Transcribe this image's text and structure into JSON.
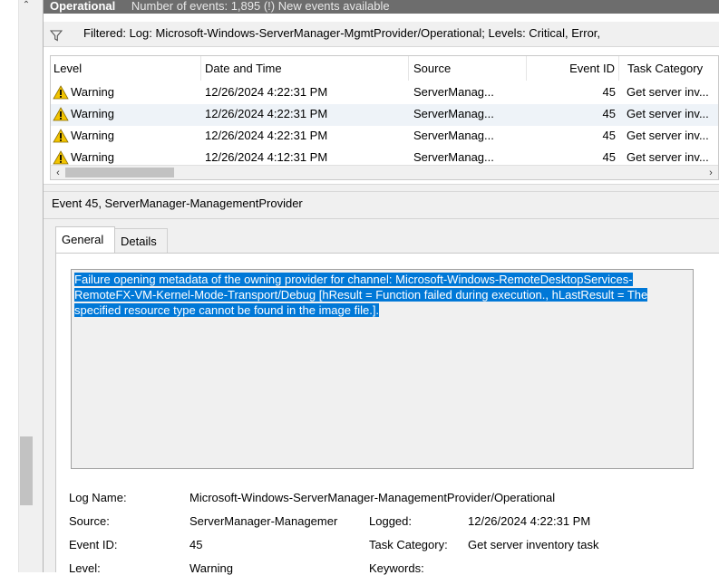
{
  "header": {
    "log_name": "Operational",
    "event_count": "Number of events: 1,895 (!) New events available"
  },
  "filter": {
    "text": "Filtered: Log: Microsoft-Windows-ServerManager-MgmtProvider/Operational; Levels: Critical, Error,"
  },
  "events_table": {
    "columns": {
      "level": "Level",
      "date": "Date and Time",
      "source": "Source",
      "event_id": "Event ID",
      "task": "Task Category"
    },
    "rows": [
      {
        "level": "Warning",
        "date": "12/26/2024 4:22:31 PM",
        "source": "ServerManag...",
        "event_id": "45",
        "task": "Get server inv..."
      },
      {
        "level": "Warning",
        "date": "12/26/2024 4:22:31 PM",
        "source": "ServerManag...",
        "event_id": "45",
        "task": "Get server inv..."
      },
      {
        "level": "Warning",
        "date": "12/26/2024 4:22:31 PM",
        "source": "ServerManag...",
        "event_id": "45",
        "task": "Get server inv..."
      },
      {
        "level": "Warning",
        "date": "12/26/2024 4:12:31 PM",
        "source": "ServerManag...",
        "event_id": "45",
        "task": "Get server inv..."
      }
    ]
  },
  "detail": {
    "title": "Event 45, ServerManager-ManagementProvider",
    "tabs": {
      "general": "General",
      "details": "Details"
    },
    "message": "Failure opening metadata of the owning provider for channel: Microsoft-Windows-RemoteDesktopServices-RemoteFX-VM-Kernel-Mode-Transport/Debug [hResult = Function failed during execution., hLastResult = The specified resource type cannot be found in the image file.].",
    "props": {
      "log_name_label": "Log Name:",
      "log_name_value": "Microsoft-Windows-ServerManager-ManagementProvider/Operational",
      "source_label": "Source:",
      "source_value": "ServerManager-Managemer",
      "logged_label": "Logged:",
      "logged_value": "12/26/2024 4:22:31 PM",
      "event_id_label": "Event ID:",
      "event_id_value": "45",
      "task_label": "Task Category:",
      "task_value": "Get server inventory task",
      "level_label": "Level:",
      "level_value": "Warning",
      "keywords_label": "Keywords:"
    }
  },
  "colors": {
    "header_bg": "#6d6d6d",
    "selection": "#0078d7",
    "warning_yellow": "#f2c400",
    "row_alt": "#eef3f8"
  }
}
